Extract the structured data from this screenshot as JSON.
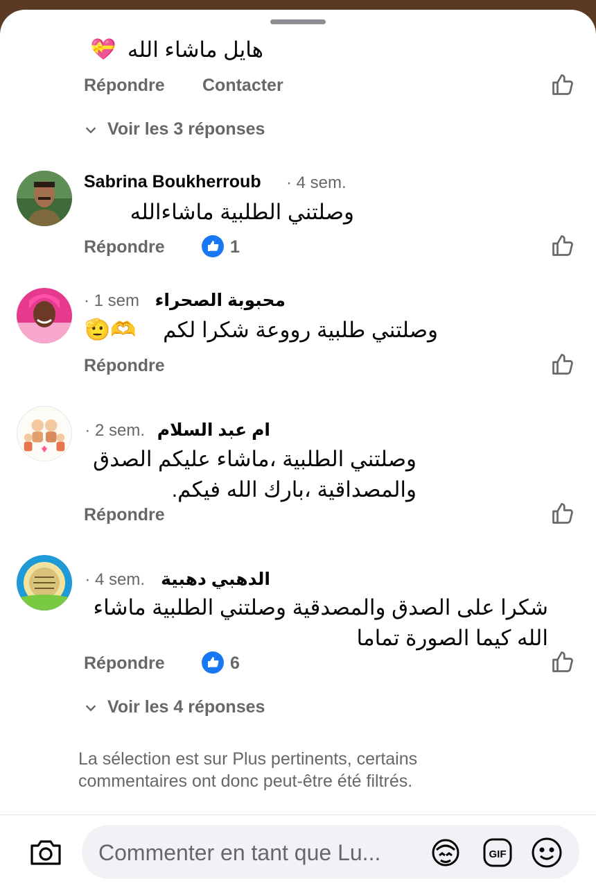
{
  "comments": [
    {
      "text": "هايل ماشاء الله",
      "emoji": "💝",
      "reply_label": "Répondre",
      "contact_label": "Contacter"
    },
    {
      "author": "Sabrina Boukherroub",
      "time": "· 4 sem.",
      "text": "وصلتني الطلبية ماشاءالله",
      "reply_label": "Répondre",
      "reaction_count": "1"
    },
    {
      "author": "محبوبة  الصحراء",
      "time": "· 1 sem",
      "text": "وصلتني طلبية رووعة شكرا لكم",
      "emoji": "🫡🫶",
      "reply_label": "Répondre"
    },
    {
      "author": "ام عبد  السلام",
      "time": "· 2 sem.",
      "text_line1": "وصلتني الطلبية ،ماشاء عليكم الصدق",
      "text_line2": "والمصداقية ،بارك الله فيكم.",
      "reply_label": "Répondre"
    },
    {
      "author": "الدهبي  دهبية",
      "time": "· 4 sem.",
      "text_line1": "شكرا على الصدق والمصدقية وصلتني الطلبية ماشاء",
      "text_line2": "الله كيما الصورة تماما",
      "reply_label": "Répondre",
      "reaction_count": "6"
    }
  ],
  "view_replies_1": "Voir les 3 réponses",
  "view_replies_2": "Voir les 4 réponses",
  "filter_note": "La sélection est sur Plus pertinents, certains commentaires ont donc peut-être été filtrés.",
  "composer": {
    "placeholder": "Commenter en tant que Lu...",
    "icons": [
      "camera-icon",
      "avatar-sticker-icon",
      "gif-icon",
      "emoji-icon"
    ]
  },
  "colors": {
    "like_blue": "#1877f2",
    "secondary_text": "#65676b"
  }
}
